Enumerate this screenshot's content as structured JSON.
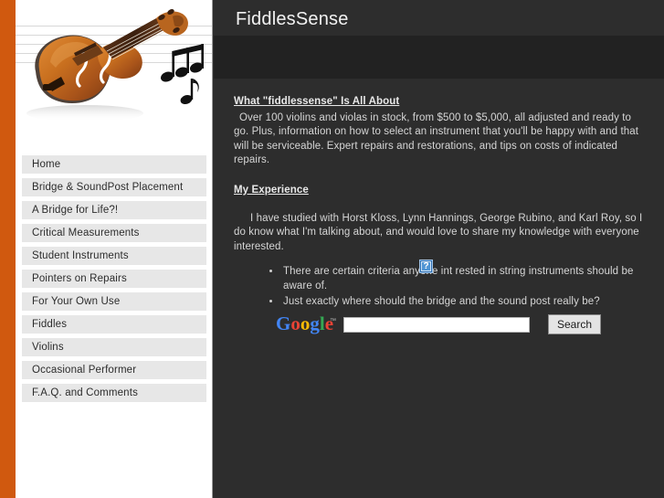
{
  "site": {
    "title": "FiddlesSense"
  },
  "theme": {
    "accent_orange": "#d0590f",
    "page_dark": "#2d2d2d",
    "title_band_dark": "#222222",
    "nav_item_bg": "#e7e7e7",
    "body_text": "#d6d6d6"
  },
  "hero": {
    "image_alt": "violin-photo",
    "notes_alt": "music-notes"
  },
  "sidebar": {
    "items": [
      {
        "label": "Home"
      },
      {
        "label": "Bridge & SoundPost Placement"
      },
      {
        "label": "A Bridge for Life?!"
      },
      {
        "label": "Critical Measurements"
      },
      {
        "label": "Student Instruments"
      },
      {
        "label": "Pointers on Repairs"
      },
      {
        "label": "For Your Own Use"
      },
      {
        "label": "Fiddles"
      },
      {
        "label": "Violins"
      },
      {
        "label": "Occasional Performer"
      },
      {
        "label": "F.A.Q. and Comments"
      }
    ]
  },
  "main": {
    "section_one": {
      "heading": "What \"fiddlessense\" Is All About",
      "paragraph": "Over 100 violins and violas in stock, from $500 to $5,000, all adjusted and ready to go. Plus, information on how to select an instrument that you'll be happy with and that will be serviceable. Expert repairs and restorations, and tips on costs of indicated repairs."
    },
    "section_two": {
      "heading": "My Experience",
      "paragraph": "I have studied with Horst Kloss, Lynn Hannings, George Rubino, and Karl Roy, so I do know what I'm talking about, and would love to share my knowledge with everyone interested.",
      "bullets": [
        "There are certain criteria anyone int rested in string instruments should be aware of.",
        "Just exactly where should the bridge and the sound post really be?"
      ]
    },
    "broken_image": {
      "glyph": "?"
    }
  },
  "search": {
    "logo_letters": [
      {
        "char": "G",
        "color": "#4285f4"
      },
      {
        "char": "o",
        "color": "#ea4335"
      },
      {
        "char": "o",
        "color": "#fbbc05"
      },
      {
        "char": "g",
        "color": "#4285f4"
      },
      {
        "char": "l",
        "color": "#34a853"
      },
      {
        "char": "e",
        "color": "#ea4335"
      }
    ],
    "input_value": "",
    "placeholder": "",
    "button_label": "Search"
  }
}
